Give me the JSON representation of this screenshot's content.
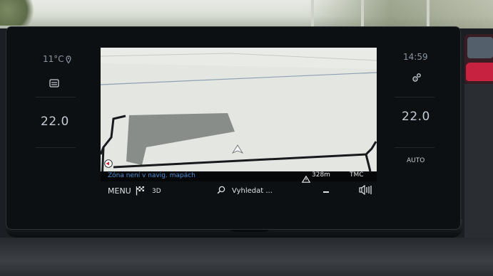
{
  "left_panel": {
    "outside_temp": "11°C",
    "location_icon": "location-pin-icon",
    "seat_icon": "seat-icon",
    "temp": "22.0"
  },
  "right_panel": {
    "clock": "14:59",
    "settings_icon": "gear-icon",
    "temp": "22.0",
    "auto_label": "AUTO"
  },
  "map": {
    "zone_notice": "Zóna není v navig. mapách",
    "distance": "328m",
    "traffic_label": "TMC",
    "warning_icon": "warning-triangle-icon",
    "position_icon": "vehicle-arrow-icon",
    "compass_icon": "compass-icon"
  },
  "toolbar": {
    "menu_label": "MENU",
    "flag_icon": "destination-flag-icon",
    "view_label": "3D",
    "search_icon": "search-icon",
    "search_label": "Vyhledat ...",
    "minus_icon": "minus-icon",
    "volume_icon": "volume-icon"
  },
  "colors": {
    "map_bg": "#e3e6e1",
    "zone_text": "#4f8fd8",
    "bezel": "#0d1013"
  }
}
